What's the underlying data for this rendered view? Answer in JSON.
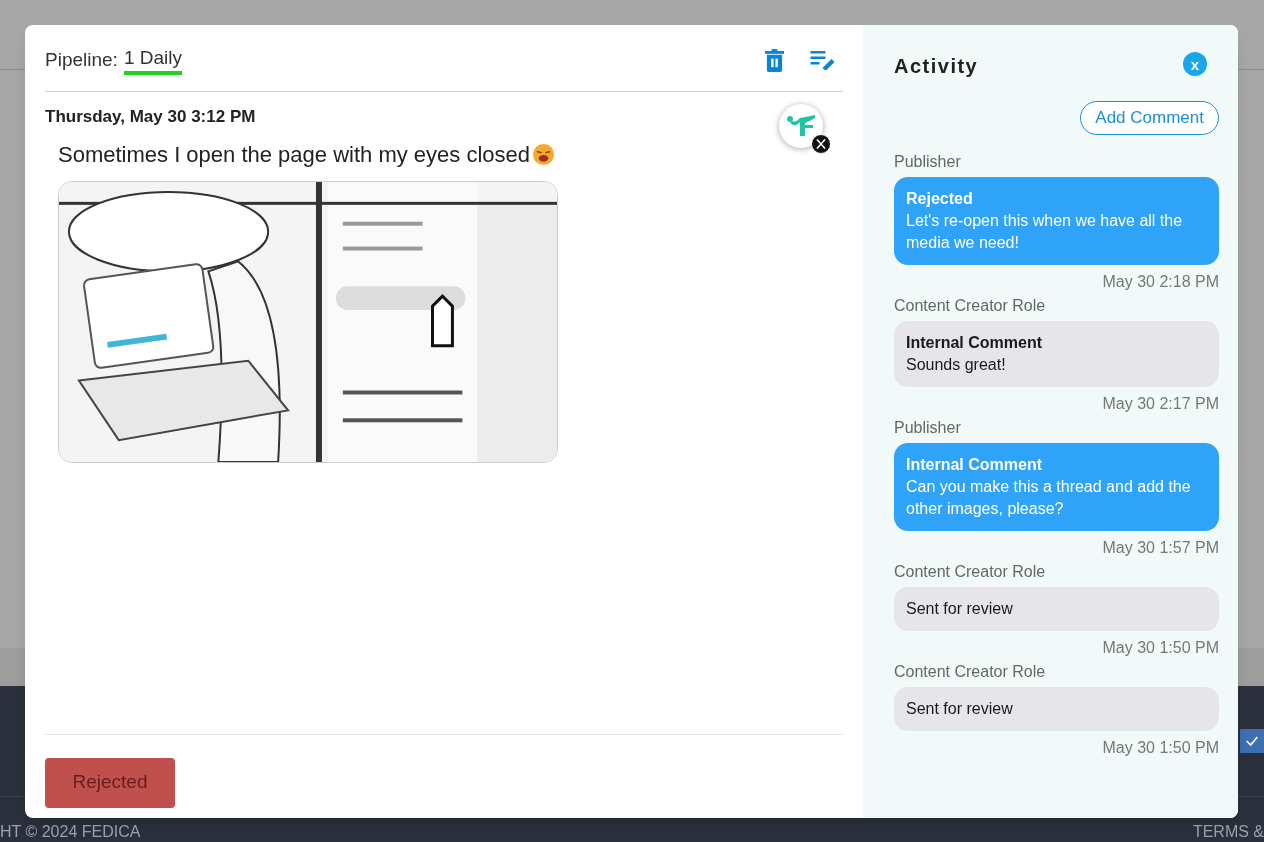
{
  "background": {
    "footer_left": "HT © 2024 FEDICA",
    "footer_right": "TERMS &"
  },
  "post": {
    "pipeline_label": "Pipeline:",
    "pipeline_value": "1 Daily",
    "date": "Thursday, May 30 3:12 PM",
    "text": "Sometimes I open the page with my eyes closed",
    "status_button": "Rejected"
  },
  "activity": {
    "title": "Activity",
    "close": "x",
    "add_comment": "Add Comment",
    "comments": [
      {
        "author": "Publisher",
        "kind": "publisher",
        "title": "Rejected",
        "body": "Let's re-open this when we have all the media we need!",
        "time": "May 30 2:18 PM"
      },
      {
        "author": "Content Creator Role",
        "kind": "creator",
        "title": "Internal Comment",
        "body": "Sounds great!",
        "time": "May 30 2:17 PM"
      },
      {
        "author": "Publisher",
        "kind": "publisher",
        "title": "Internal Comment",
        "body": "Can you make this a thread and add the other images, please?",
        "time": "May 30 1:57 PM"
      },
      {
        "author": "Content Creator Role",
        "kind": "creator",
        "body": "Sent for review",
        "time": "May 30 1:50 PM"
      },
      {
        "author": "Content Creator Role",
        "kind": "creator",
        "body": "Sent for review",
        "time": "May 30 1:50 PM"
      }
    ]
  }
}
